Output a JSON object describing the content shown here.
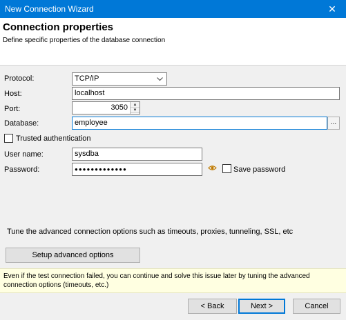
{
  "window": {
    "title": "New Connection Wizard",
    "close_glyph": "✕"
  },
  "header": {
    "title": "Connection properties",
    "subtitle": "Define specific properties of the database connection"
  },
  "form": {
    "protocol_label": "Protocol:",
    "protocol_value": "TCP/IP",
    "host_label": "Host:",
    "host_value": "localhost",
    "port_label": "Port:",
    "port_value": "3050",
    "database_label": "Database:",
    "database_value": "employee",
    "browse_label": "...",
    "trusted_auth_label": "Trusted authentication",
    "trusted_auth_checked": false,
    "username_label": "User name:",
    "username_value": "sysdba",
    "password_label": "Password:",
    "password_value": "●●●●●●●●●●●●●",
    "save_password_label": "Save password",
    "save_password_checked": false
  },
  "advanced": {
    "description": "Tune the advanced connection options such as timeouts, proxies, tunneling, SSL, etc",
    "button_label": "Setup advanced options"
  },
  "info": {
    "text": "Even if the test connection failed, you can continue and solve this issue later by tuning the advanced connection options (timeouts, etc.)"
  },
  "footer": {
    "back_label": "< Back",
    "next_label": "Next >",
    "cancel_label": "Cancel"
  },
  "colors": {
    "titlebar": "#0078d7",
    "info_background": "#ffffe1",
    "focus_border": "#0078d7"
  },
  "icons": {
    "caret": "chevron-down-icon",
    "eye": "eye-icon",
    "close": "close-icon"
  }
}
